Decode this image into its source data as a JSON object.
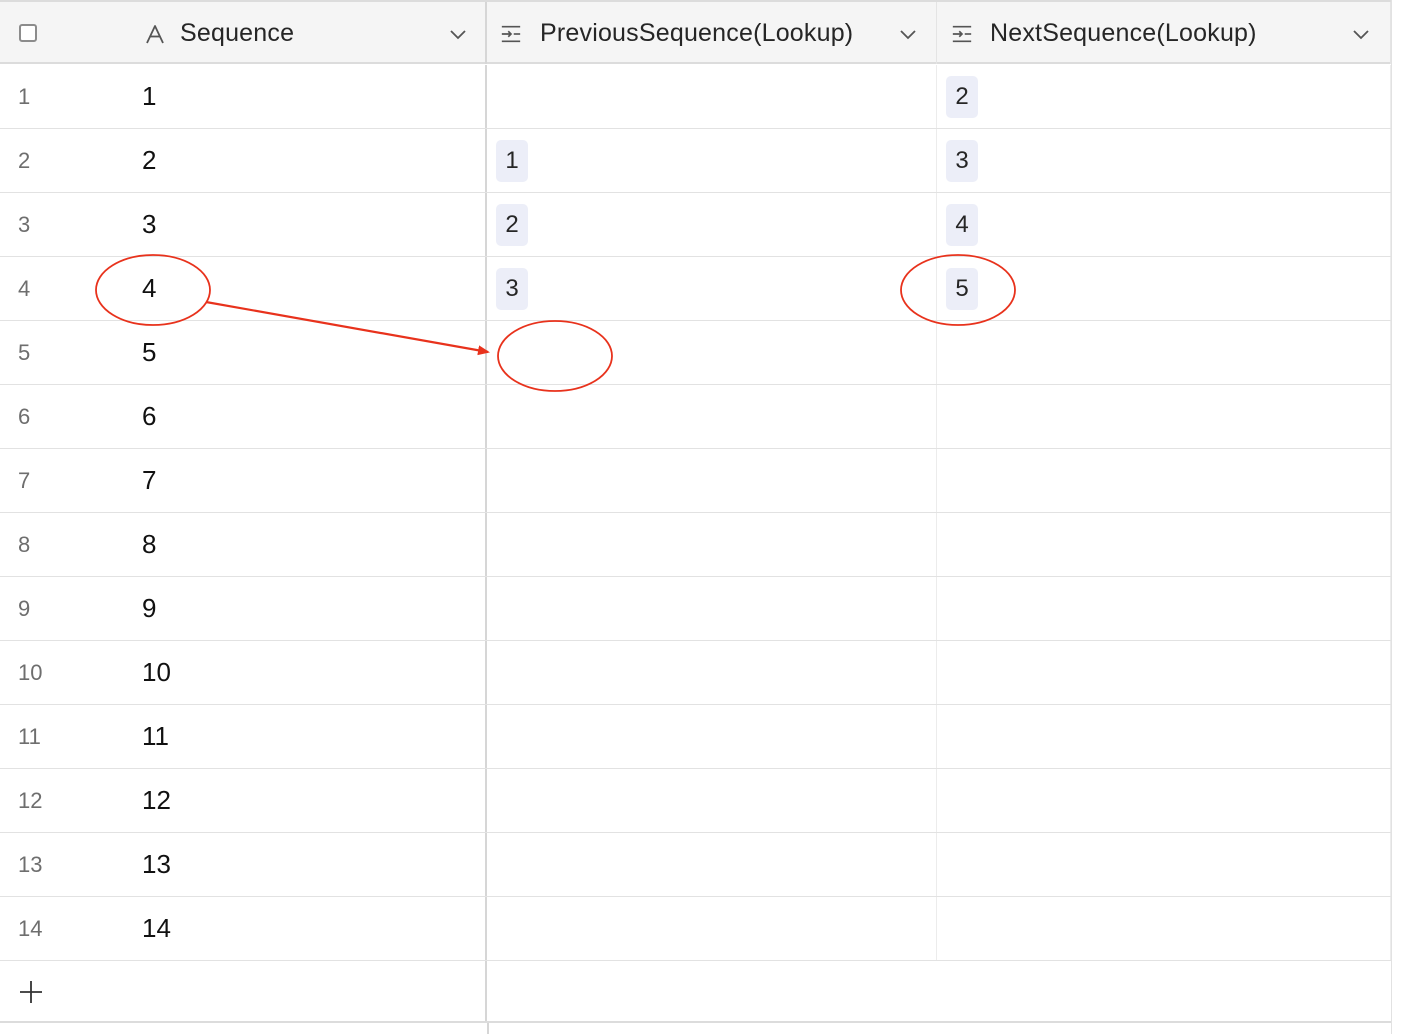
{
  "columns": {
    "sequence": {
      "label": "Sequence",
      "icon": "text-field-icon"
    },
    "previous": {
      "label": "PreviousSequence(Lookup)",
      "icon": "lookup-field-icon"
    },
    "next": {
      "label": "NextSequence(Lookup)",
      "icon": "lookup-field-icon"
    }
  },
  "rows": [
    {
      "num": "1",
      "seq": "1",
      "prev": "",
      "next": "2"
    },
    {
      "num": "2",
      "seq": "2",
      "prev": "1",
      "next": "3"
    },
    {
      "num": "3",
      "seq": "3",
      "prev": "2",
      "next": "4"
    },
    {
      "num": "4",
      "seq": "4",
      "prev": "3",
      "next": "5"
    },
    {
      "num": "5",
      "seq": "5",
      "prev": "",
      "next": ""
    },
    {
      "num": "6",
      "seq": "6",
      "prev": "",
      "next": ""
    },
    {
      "num": "7",
      "seq": "7",
      "prev": "",
      "next": ""
    },
    {
      "num": "8",
      "seq": "8",
      "prev": "",
      "next": ""
    },
    {
      "num": "9",
      "seq": "9",
      "prev": "",
      "next": ""
    },
    {
      "num": "10",
      "seq": "10",
      "prev": "",
      "next": ""
    },
    {
      "num": "11",
      "seq": "11",
      "prev": "",
      "next": ""
    },
    {
      "num": "12",
      "seq": "12",
      "prev": "",
      "next": ""
    },
    {
      "num": "13",
      "seq": "13",
      "prev": "",
      "next": ""
    },
    {
      "num": "14",
      "seq": "14",
      "prev": "",
      "next": ""
    }
  ],
  "annotations": {
    "color": "#e8321c",
    "items": [
      "circle-row4-sequence",
      "circle-row5-previous",
      "circle-row4-next",
      "arrow-row4-to-row5-previous"
    ]
  },
  "colors": {
    "header_bg": "#f5f5f5",
    "tag_bg": "#eceef8",
    "annotation": "#e8321c"
  }
}
